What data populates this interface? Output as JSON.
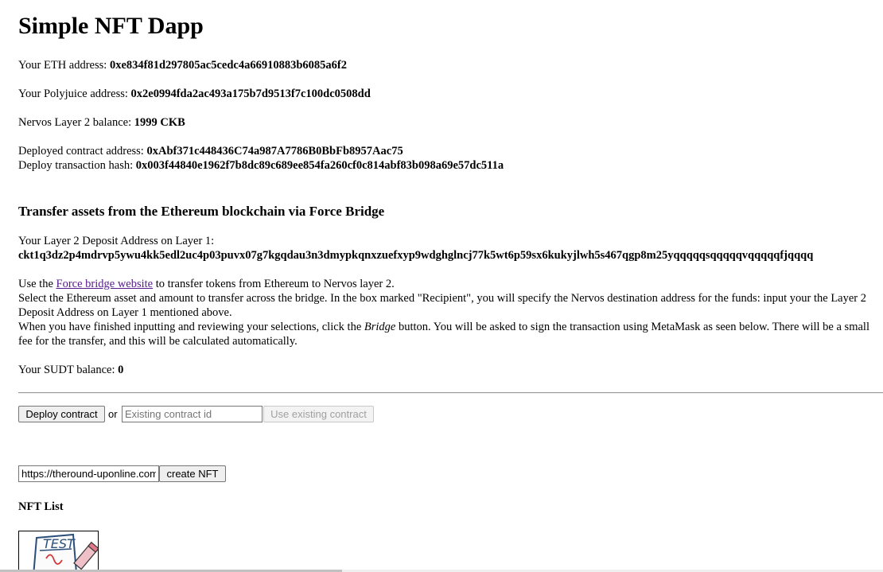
{
  "header": {
    "title": "Simple NFT Dapp"
  },
  "account": {
    "eth_label": "Your ETH address: ",
    "eth_address": "0xe834f81d297805ac5cedc4a66910883b6085a6f2",
    "polyjuice_label": "Your Polyjuice address: ",
    "polyjuice_address": "0x2e0994fda2ac493a175b7d9513f7c100dc0508dd",
    "balance_label": "Nervos Layer 2 balance: ",
    "balance_value": "1999 CKB"
  },
  "contract": {
    "deployed_label": "Deployed contract address: ",
    "deployed_address": "0xAbf371c448436C74a987A7786B0BbFb8957Aac75",
    "tx_label": "Deploy transaction hash: ",
    "tx_hash": "0x003f44840e1962f7b8dc89c689ee854fa260cf0c814abf83b098a69e57dc511a"
  },
  "bridge": {
    "heading": "Transfer assets from the Ethereum blockchain via Force Bridge",
    "deposit_label": "Your Layer 2 Deposit Address on Layer 1:",
    "deposit_address": "ckt1q3dz2p4mdrvp5ywu4kk5edl2uc4p03puvx07g7kgqdau3n3dmypkqnxzuefxyp9wdghglncj77k5wt6p59sx6kukyjlwh5s467qgp8m25yqqqqqsqqqqqvqqqqqfjqqqq",
    "use_prefix": "Use the ",
    "link_text": "Force bridge website",
    "use_suffix": " to transfer tokens from Ethereum to Nervos layer 2.",
    "select_text": "Select the Ethereum asset and amount to transfer across the bridge. In the box marked \"Recipient\", you will specify the Nervos destination address for the funds: input your the Layer 2 Deposit Address on Layer 1 mentioned above.",
    "finish_prefix": "When you have finished inputting and reviewing your selections, click the ",
    "finish_em": "Bridge",
    "finish_suffix": " button. You will be asked to sign the transaction using MetaMask as seen below. There will be a small fee for the transfer, and this will be calculated automatically.",
    "sudt_label": "Your SUDT balance: ",
    "sudt_value": "0"
  },
  "controls": {
    "deploy_button": "Deploy contract",
    "or_text": "or",
    "existing_placeholder": "Existing contract id",
    "existing_value": "",
    "use_existing_button": "Use existing contract",
    "nft_url_value": "https://theround-uponline.com",
    "create_nft_button": "create NFT"
  },
  "nft_list": {
    "heading": "NFT List",
    "items": [
      {
        "label": "TEST"
      }
    ]
  },
  "colors": {
    "link": "#551a8b",
    "separator": "#9a9a9a"
  }
}
